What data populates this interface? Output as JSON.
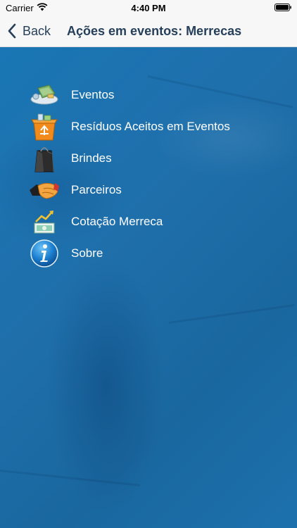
{
  "status": {
    "carrier": "Carrier",
    "time": "4:40 PM"
  },
  "nav": {
    "back_label": "Back",
    "title": "Ações em eventos: Merrecas"
  },
  "menu": [
    {
      "label": "Eventos",
      "icon": "events-icon"
    },
    {
      "label": "Resíduos Aceitos em Eventos",
      "icon": "recycle-box-icon"
    },
    {
      "label": "Brindes",
      "icon": "gift-bag-icon"
    },
    {
      "label": "Parceiros",
      "icon": "handshake-icon"
    },
    {
      "label": "Cotação Merreca",
      "icon": "chart-rising-icon"
    },
    {
      "label": "Sobre",
      "icon": "info-icon"
    }
  ],
  "colors": {
    "nav_text": "#263f5a",
    "background_blue": "#1f6fab",
    "label_white": "#ffffff"
  }
}
